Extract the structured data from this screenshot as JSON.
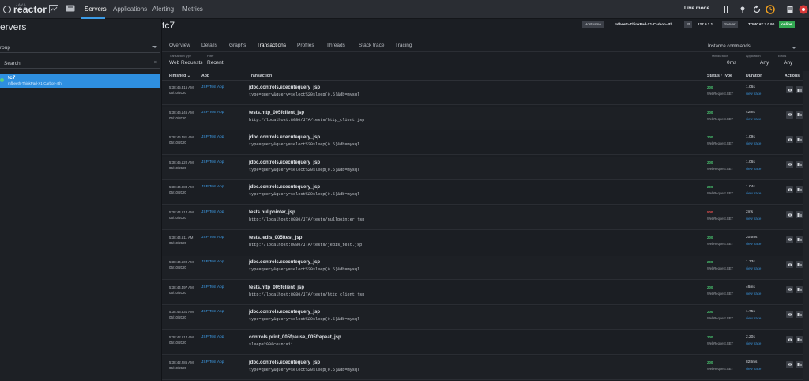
{
  "brand": {
    "sup": "JAVA",
    "name": "reactor"
  },
  "nav": {
    "items": [
      "Servers",
      "Applications",
      "Alerting",
      "Metrics"
    ],
    "live_mode": "Live mode"
  },
  "left": {
    "title": "ervers",
    "group_label": "roup",
    "search_placeholder": "Search",
    "server": {
      "name": "tc7",
      "host": "mfbeeth-ThinkPad-X1-Carbon-4th"
    }
  },
  "header": {
    "title": "tc7",
    "hostname_label": "Hostname",
    "hostname_value": "mfbeeth-ThinkPad-X1-Carbon-4th",
    "ip_label": "IP",
    "ip_value": "127.0.1.1",
    "server_label": "Server",
    "server_value": "TOMCAT 7.0.90",
    "status": "online"
  },
  "tabs": [
    "Overview",
    "Details",
    "Graphs",
    "Transactions",
    "Profiles",
    "Threads",
    "Stack trace",
    "Tracing"
  ],
  "instance_commands": "Instance commands",
  "filters": {
    "transaction_type_label": "Transaction type",
    "transaction_type": "Web Requests",
    "filter_label": "Filter",
    "filter": "Recent",
    "min_duration_label": "Min duration",
    "min_duration": "0ms",
    "application_label": "Application",
    "application": "Any",
    "errors_label": "Errors",
    "errors": "Any"
  },
  "table": {
    "headers": {
      "finished": "Finished ⌄",
      "app": "App",
      "transaction": "Transaction",
      "status": "Status / Type",
      "duration": "Duration",
      "actions": "Actions"
    },
    "view_trace": "view trace",
    "rows": [
      {
        "time": "5:38:45.316 AM",
        "date": "06/10/2020",
        "app": "JSP Test App",
        "tx": "jdbc.controls.executequery_jsp",
        "url": "type=query&query=select%20sleep(0.5)&db=mysql",
        "status": "200",
        "type": "WebRequest.GET",
        "duration": "1.06s"
      },
      {
        "time": "5:38:46.146 AM",
        "date": "06/10/2020",
        "app": "JSP Test App",
        "tx": "tests.http_005fclient_jsp",
        "url": "http://localhost:8080/JTA/tests/http_client.jsp",
        "status": "200",
        "type": "WebRequest.GET",
        "duration": "42ms"
      },
      {
        "time": "5:38:46.481 AM",
        "date": "06/10/2020",
        "app": "JSP Test App",
        "tx": "jdbc.controls.executequery_jsp",
        "url": "type=query&query=select%20sleep(0.5)&db=mysql",
        "status": "200",
        "type": "WebRequest.GET",
        "duration": "1.09s"
      },
      {
        "time": "5:38:45.120 AM",
        "date": "06/10/2020",
        "app": "JSP Test App",
        "tx": "jdbc.controls.executequery_jsp",
        "url": "type=query&query=select%20sleep(0.5)&db=mysql",
        "status": "200",
        "type": "WebRequest.GET",
        "duration": "1.06s"
      },
      {
        "time": "5:38:44.983 AM",
        "date": "06/10/2020",
        "app": "JSP Test App",
        "tx": "jdbc.controls.executequery_jsp",
        "url": "type=query&query=select%20sleep(0.5)&db=mysql",
        "status": "200",
        "type": "WebRequest.GET",
        "duration": "1.04s"
      },
      {
        "time": "5:38:44.614 AM",
        "date": "06/10/2020",
        "app": "JSP Test App",
        "tx": "tests.nullpointer_jsp",
        "url": "http://localhost:8080/JTA/tests/nullpointer.jsp",
        "status": "500",
        "type": "WebRequest.GET",
        "duration": "2ms",
        "error": true
      },
      {
        "time": "5:38:44.611 AM",
        "date": "06/10/2020",
        "app": "JSP Test App",
        "tx": "tests.jedis_005ftest_jsp",
        "url": "http://localhost:8080/JTA/tests/jedis_test.jsp",
        "status": "200",
        "type": "WebRequest.GET",
        "duration": "204ms"
      },
      {
        "time": "5:38:44.500 AM",
        "date": "06/10/2020",
        "app": "JSP Test App",
        "tx": "jdbc.controls.executequery_jsp",
        "url": "type=query&query=select%20sleep(0.5)&db=mysql",
        "status": "200",
        "type": "WebRequest.GET",
        "duration": "1.73s"
      },
      {
        "time": "5:38:44.497 AM",
        "date": "06/10/2020",
        "app": "JSP Test App",
        "tx": "tests.http_005fclient_jsp",
        "url": "http://localhost:8080/JTA/tests/http_client.jsp",
        "status": "200",
        "type": "WebRequest.GET",
        "duration": "46ms"
      },
      {
        "time": "5:38:43.631 AM",
        "date": "06/10/2020",
        "app": "JSP Test App",
        "tx": "jdbc.controls.executequery_jsp",
        "url": "type=query&query=select%20sleep(0.5)&db=mysql",
        "status": "200",
        "type": "WebRequest.GET",
        "duration": "1.75s"
      },
      {
        "time": "5:38:42.614 AM",
        "date": "06/10/2020",
        "app": "JSP Test App",
        "tx": "controls.print_005fpause_005frepeat_jsp",
        "url": "sleep=200&count=11",
        "status": "200",
        "type": "WebRequest.GET",
        "duration": "2.20s"
      },
      {
        "time": "5:38:42.286 AM",
        "date": "06/10/2020",
        "app": "JSP Test App",
        "tx": "jdbc.controls.executequery_jsp",
        "url": "type=query&query=select%20sleep(0.5)&db=mysql",
        "status": "200",
        "type": "WebRequest.GET",
        "duration": "828ms"
      }
    ]
  }
}
